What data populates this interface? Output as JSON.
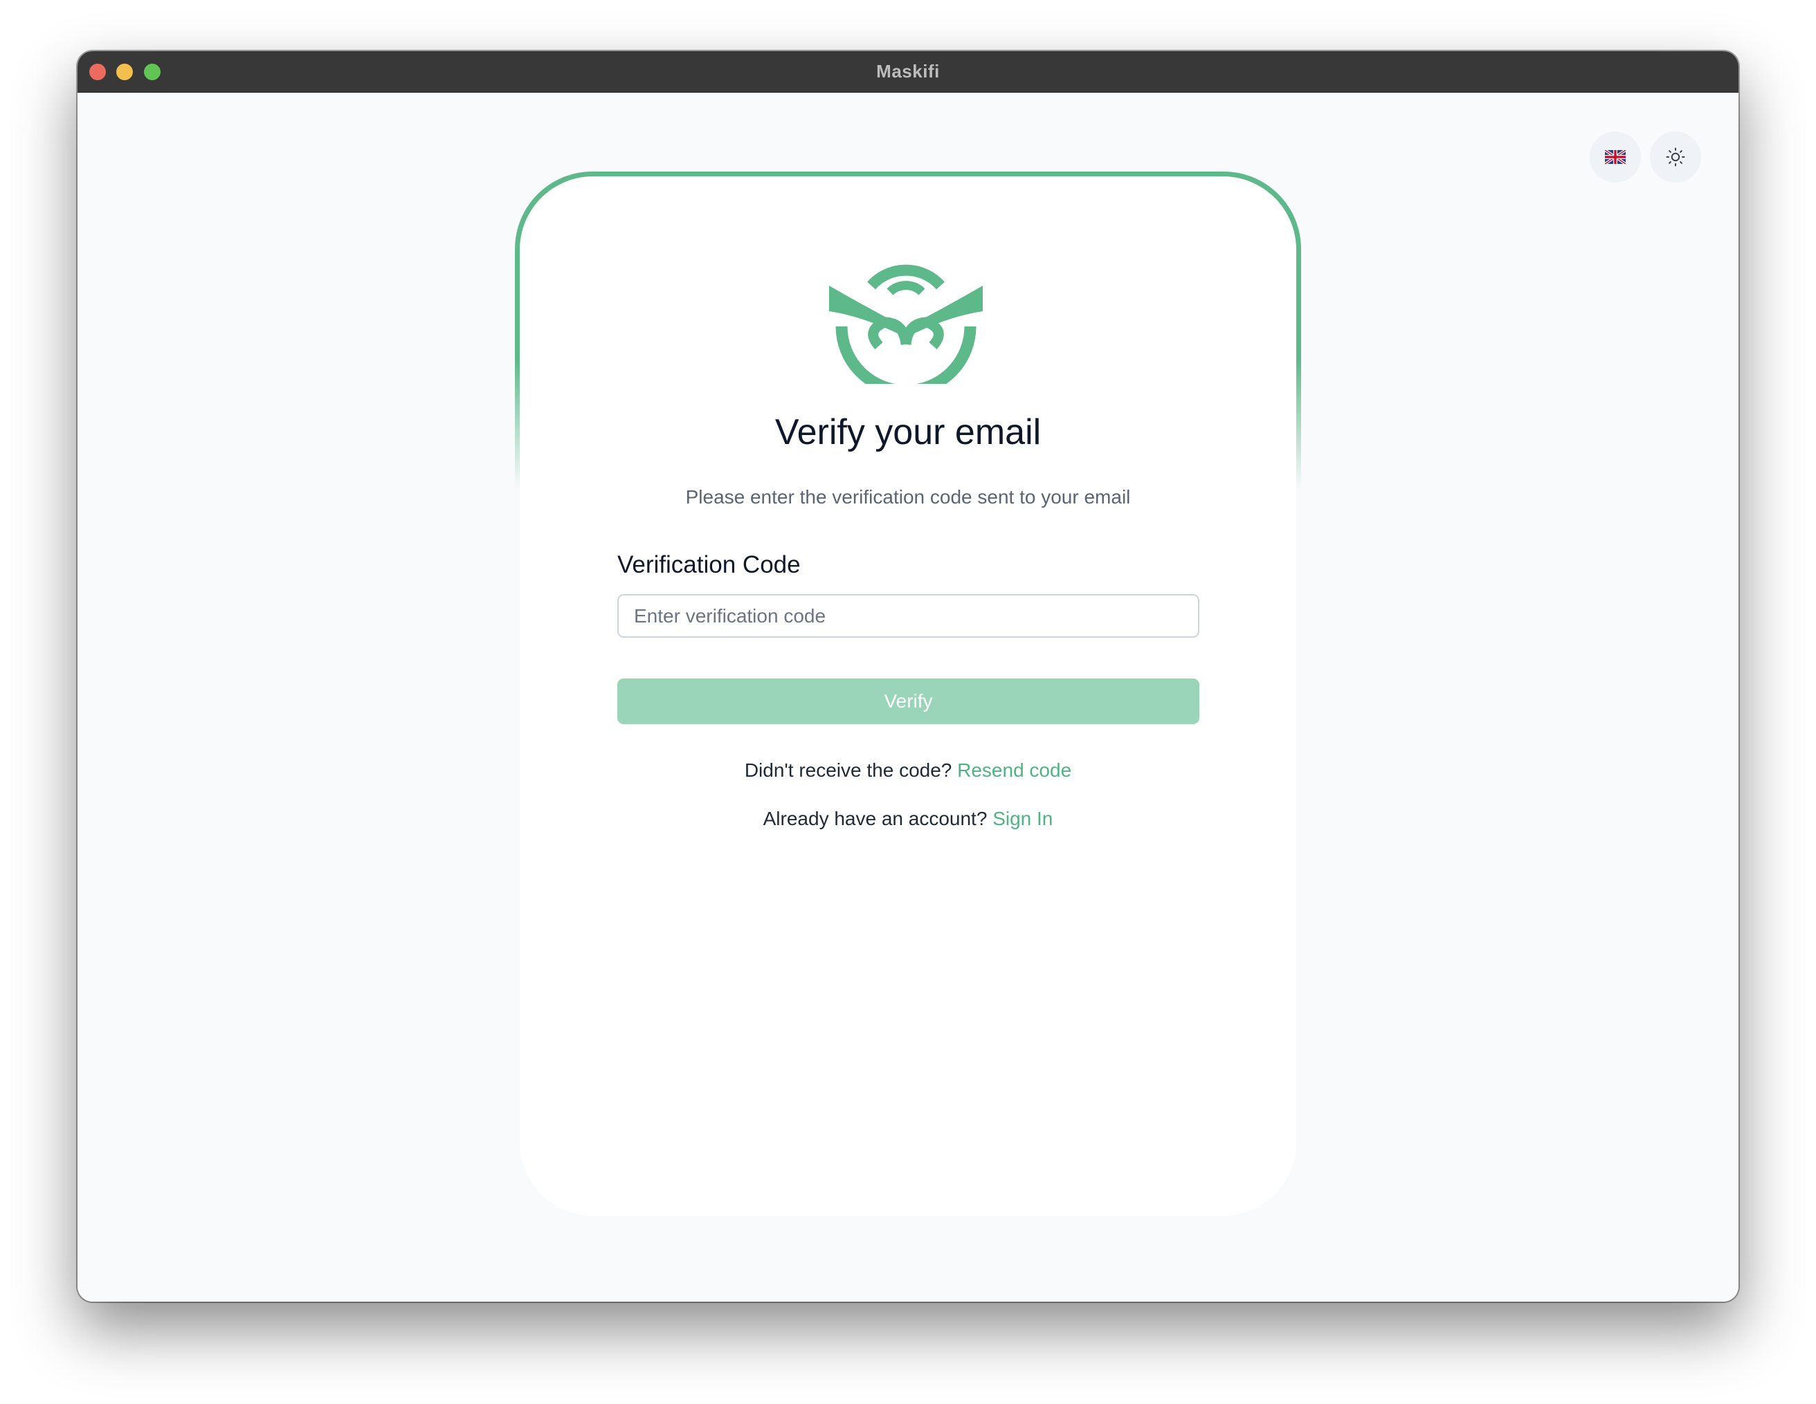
{
  "window": {
    "title": "Maskifi"
  },
  "toolbar": {
    "language_icon": "uk-flag-icon",
    "theme_icon": "sun-icon"
  },
  "verify": {
    "heading": "Verify your email",
    "subheading": "Please enter the verification code sent to your email",
    "field_label": "Verification Code",
    "input_value": "",
    "input_placeholder": "Enter verification code",
    "button_label": "Verify",
    "resend_prompt": "Didn't receive the code?",
    "resend_link": "Resend code",
    "signin_prompt": "Already have an account?",
    "signin_link": "Sign In"
  },
  "colors": {
    "accent": "#5db88a",
    "button_disabled": "#9ad5b9",
    "titlebar": "#383838"
  }
}
